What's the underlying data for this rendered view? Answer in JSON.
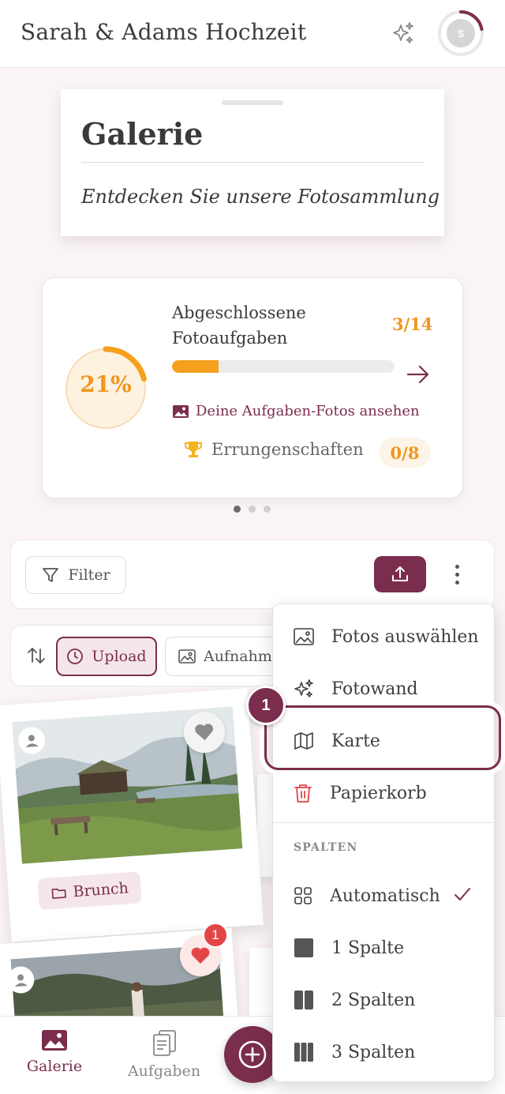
{
  "header": {
    "title": "Sarah & Adams Hochzeit",
    "avatar_initial": "S",
    "sparkle_icon": "sparkle-icon"
  },
  "gallery_card": {
    "title": "Galerie",
    "subtitle": "Entdecken Sie unsere Fotosammlung"
  },
  "stats": {
    "percent_label": "21%",
    "percent_value": 21,
    "title": "Abgeschlossene Fotoaufgaben",
    "count": "3/14",
    "progress": 0.21,
    "view_link": "Deine Aufgaben-Fotos ansehen",
    "achievements_label": "Errungenschaften",
    "achievements_count": "0/8",
    "accent_color": "#f0961e"
  },
  "toolbar": {
    "filter_label": "Filter"
  },
  "sort": {
    "upload_label": "Upload",
    "capture_label": "Aufnahme"
  },
  "photos": [
    {
      "tag": "Brunch",
      "liked": true
    },
    {
      "like_count": "1",
      "liked": true
    }
  ],
  "nav": {
    "gallery_label": "Galerie",
    "tasks_label": "Aufgaben"
  },
  "menu": {
    "items": [
      {
        "label": "Fotos auswählen",
        "icon": "image-icon"
      },
      {
        "label": "Fotowand",
        "icon": "sparkle-icon"
      },
      {
        "label": "Karte",
        "icon": "map-icon"
      },
      {
        "label": "Papierkorb",
        "icon": "trash-icon"
      }
    ],
    "section_label": "SPALTEN",
    "columns": [
      {
        "label": "Automatisch",
        "icon": "grid-icon",
        "selected": true
      },
      {
        "label": "1 Spalte",
        "icon": "one-column-icon"
      },
      {
        "label": "2 Spalten",
        "icon": "two-columns-icon"
      },
      {
        "label": "3 Spalten",
        "icon": "three-columns-icon"
      }
    ]
  },
  "tutorial": {
    "step": "1"
  },
  "colors": {
    "brand": "#7b2d4e",
    "accent": "#f0961e",
    "background": "#fbf4f5"
  }
}
